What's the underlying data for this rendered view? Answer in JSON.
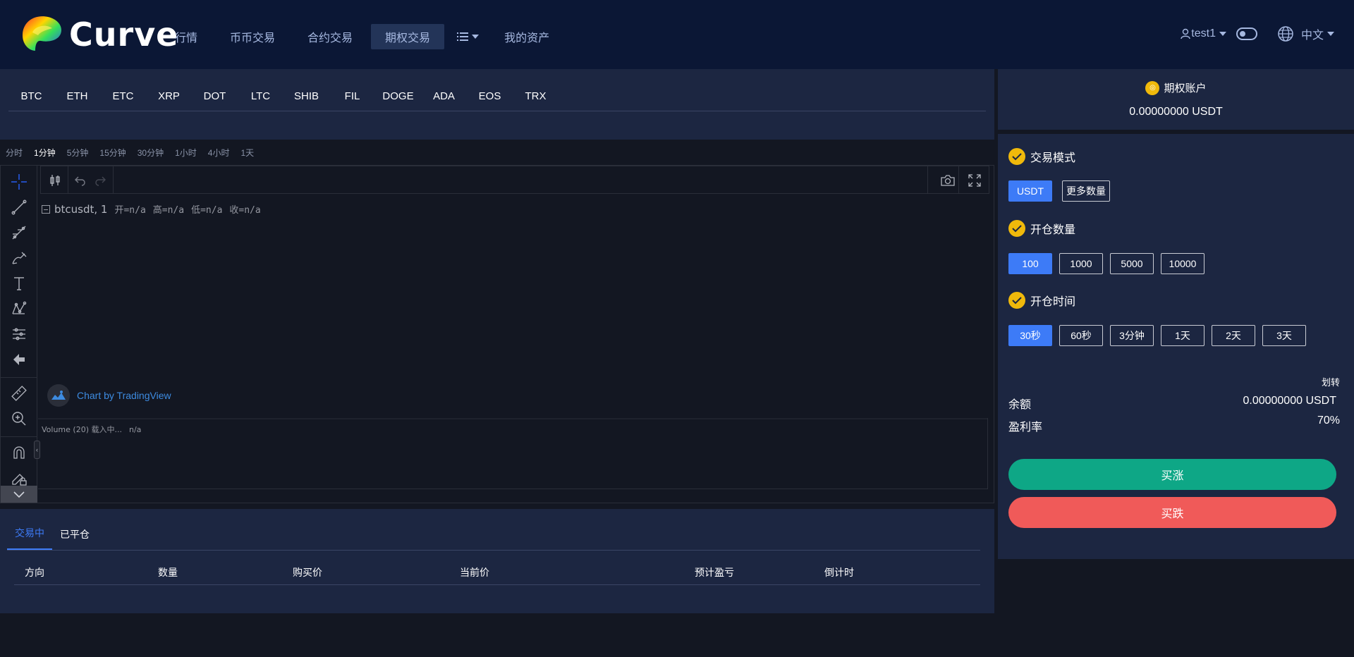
{
  "header": {
    "brand": "Curve",
    "nav": [
      "行情",
      "币币交易",
      "合约交易",
      "期权交易",
      "我的资产"
    ],
    "active_nav": "期权交易",
    "user": "test1",
    "language": "中文"
  },
  "coins": [
    "BTC",
    "ETH",
    "ETC",
    "XRP",
    "DOT",
    "LTC",
    "SHIB",
    "FIL",
    "DOGE",
    "ADA",
    "EOS",
    "TRX"
  ],
  "intervals": [
    "分时",
    "1分钟",
    "5分钟",
    "15分钟",
    "30分钟",
    "1小时",
    "4小时",
    "1天"
  ],
  "active_interval": "1分钟",
  "chart": {
    "symbol": "btcusdt, 1",
    "ohlc": [
      "开=n/a",
      "高=n/a",
      "低=n/a",
      "收=n/a"
    ],
    "brand": "Chart by TradingView",
    "volume_label": "Volume (20) 载入中...",
    "volume_value": "n/a"
  },
  "orders": {
    "tabs": [
      "交易中",
      "已平仓"
    ],
    "columns": [
      "方向",
      "数量",
      "购买价",
      "当前价",
      "预计盈亏",
      "倒计时"
    ]
  },
  "account": {
    "title": "期权账户",
    "balance": "0.00000000 USDT"
  },
  "trade": {
    "mode_title": "交易模式",
    "modes": [
      "USDT",
      "更多数量"
    ],
    "qty_title": "开仓数量",
    "quantities": [
      "100",
      "1000",
      "5000",
      "10000"
    ],
    "time_title": "开仓时间",
    "times": [
      "30秒",
      "60秒",
      "3分钟",
      "1天",
      "2天",
      "3天"
    ],
    "transfer": "划转",
    "balance_label": "余额",
    "balance_value": "0.00000000 USDT",
    "rate_label": "盈利率",
    "rate_value": "70%",
    "buy_up": "买涨",
    "buy_down": "买跌"
  },
  "colors": {
    "header_bg": "#0b1735",
    "panel_bg": "#1c2641",
    "accent": "#3d7bf7",
    "up": "#0ea786",
    "down": "#f05a59",
    "gold": "#f0b90b"
  }
}
